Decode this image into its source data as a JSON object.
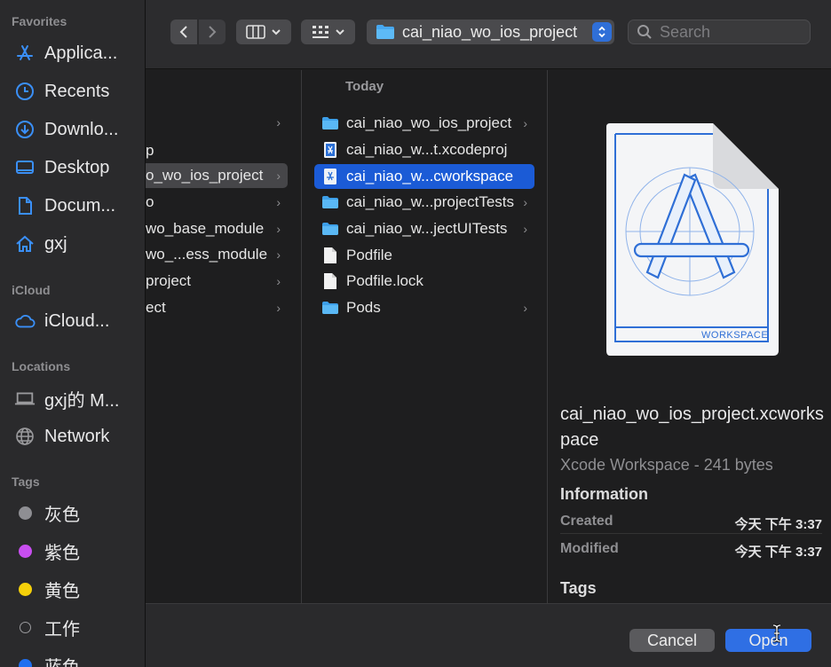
{
  "sidebar": {
    "favorites_title": "Favorites",
    "favorites": [
      {
        "label": "Applica...",
        "icon": "app-store-icon"
      },
      {
        "label": "Recents",
        "icon": "clock-icon"
      },
      {
        "label": "Downlo...",
        "icon": "download-icon"
      },
      {
        "label": "Desktop",
        "icon": "desktop-icon"
      },
      {
        "label": "Docum...",
        "icon": "document-icon"
      },
      {
        "label": "gxj",
        "icon": "home-icon"
      }
    ],
    "icloud_title": "iCloud",
    "icloud": [
      {
        "label": "iCloud...",
        "icon": "cloud-icon"
      }
    ],
    "locations_title": "Locations",
    "locations": [
      {
        "label": "gxj的 M...",
        "icon": "laptop-icon"
      },
      {
        "label": "Network",
        "icon": "globe-icon"
      }
    ],
    "tags_title": "Tags",
    "tags": [
      {
        "label": "灰色",
        "color": "#8e8e93"
      },
      {
        "label": "紫色",
        "color": "#c84ef0"
      },
      {
        "label": "黄色",
        "color": "#f5d00a"
      },
      {
        "label": "工作",
        "color": "none"
      },
      {
        "label": "蓝色",
        "color": "#1f6ff0"
      }
    ]
  },
  "toolbar": {
    "path_label": "cai_niao_wo_ios_project",
    "search_placeholder": "Search"
  },
  "column1": {
    "items": [
      {
        "label": "",
        "has_children": true
      },
      {
        "label": "p",
        "has_children": false
      },
      {
        "label": "o_wo_ios_project",
        "has_children": true,
        "selected": true
      },
      {
        "label": "o",
        "has_children": true
      },
      {
        "label": "wo_base_module",
        "has_children": true
      },
      {
        "label": "wo_...ess_module",
        "has_children": true
      },
      {
        "label": "project",
        "has_children": true
      },
      {
        "label": "ect",
        "has_children": true
      }
    ]
  },
  "column2": {
    "header": "Today",
    "items": [
      {
        "label": "cai_niao_wo_ios_project",
        "icon": "folder-icon",
        "has_children": true
      },
      {
        "label": "cai_niao_w...t.xcodeproj",
        "icon": "xcodeproj-icon",
        "has_children": false
      },
      {
        "label": "cai_niao_w...cworkspace",
        "icon": "xcworkspace-icon",
        "has_children": false,
        "selected": true
      },
      {
        "label": "cai_niao_w...projectTests",
        "icon": "folder-icon",
        "has_children": true
      },
      {
        "label": "cai_niao_w...jectUITests",
        "icon": "folder-icon",
        "has_children": true
      },
      {
        "label": "Podfile",
        "icon": "file-icon",
        "has_children": false
      },
      {
        "label": "Podfile.lock",
        "icon": "file-icon",
        "has_children": false
      },
      {
        "label": "Pods",
        "icon": "folder-icon",
        "has_children": true
      }
    ]
  },
  "preview": {
    "badge": "WORKSPACE",
    "filename": "cai_niao_wo_ios_project.xcworkspace",
    "kind": "Xcode Workspace - 241 bytes",
    "info_title": "Information",
    "created_label": "Created",
    "created_value": "今天 下午 3:37",
    "modified_label": "Modified",
    "modified_value": "今天 下午 3:37",
    "tags_title": "Tags"
  },
  "buttons": {
    "cancel": "Cancel",
    "open": "Open"
  }
}
